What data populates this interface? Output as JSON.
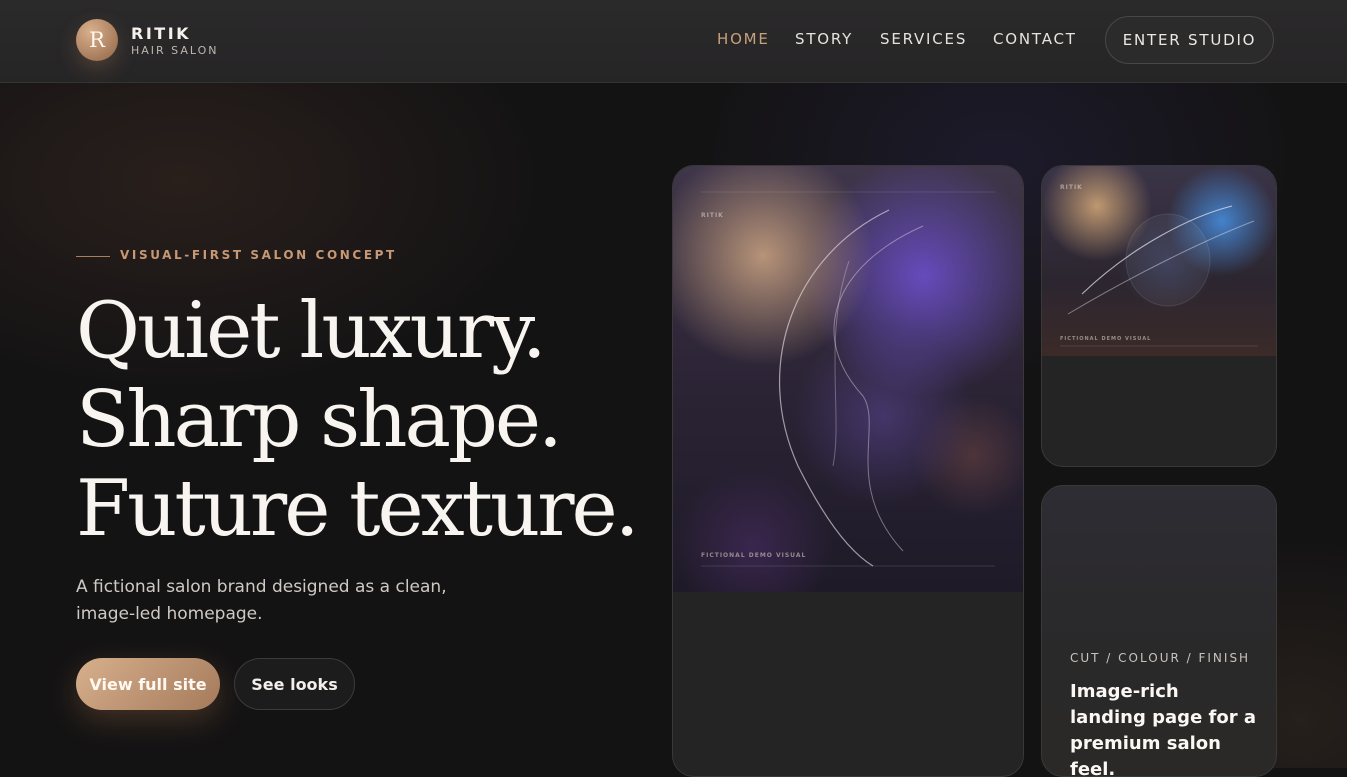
{
  "brand": {
    "initial": "R",
    "name": "RITIK",
    "subtitle": "HAIR SALON"
  },
  "nav": {
    "items": [
      {
        "label": "HOME",
        "active": true
      },
      {
        "label": "STORY",
        "active": false
      },
      {
        "label": "SERVICES",
        "active": false
      },
      {
        "label": "CONTACT",
        "active": false
      }
    ],
    "cta_label": "ENTER STUDIO"
  },
  "hero": {
    "eyebrow": "VISUAL-FIRST SALON CONCEPT",
    "headline": [
      "Quiet luxury.",
      "Sharp shape.",
      "Future texture."
    ],
    "description": "A fictional salon brand designed as a clean, image-led homepage.",
    "primary_button": "View full site",
    "secondary_button": "See looks"
  },
  "cards": {
    "main": {
      "mark": "RITIK",
      "caption": "FICTIONAL DEMO VISUAL"
    },
    "top": {
      "mark": "RITIK",
      "caption": "FICTIONAL DEMO VISUAL"
    },
    "bottom": {
      "tag": "CUT / COLOUR / FINISH",
      "text": "Image-rich landing page for a premium salon feel."
    }
  },
  "colors": {
    "accent": "#c9a07c",
    "background": "#141314",
    "header": "#2a292a"
  }
}
